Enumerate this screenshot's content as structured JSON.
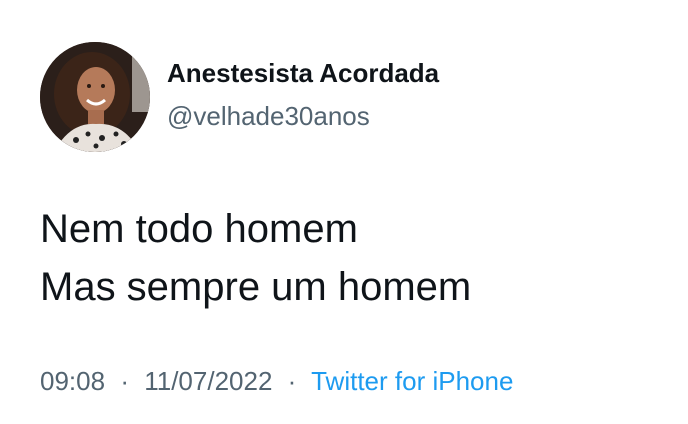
{
  "author": {
    "display_name": "Anestesista Acordada",
    "handle": "@velhade30anos",
    "avatar_icon": "profile-photo"
  },
  "tweet": {
    "lines": [
      "Nem todo homem",
      "Mas sempre um homem"
    ]
  },
  "meta": {
    "time": "09:08",
    "date": "11/07/2022",
    "separator": "·",
    "source": "Twitter for iPhone"
  },
  "colors": {
    "text": "#0f1419",
    "secondary": "#536471",
    "link": "#1d9bf0",
    "background": "#ffffff"
  }
}
